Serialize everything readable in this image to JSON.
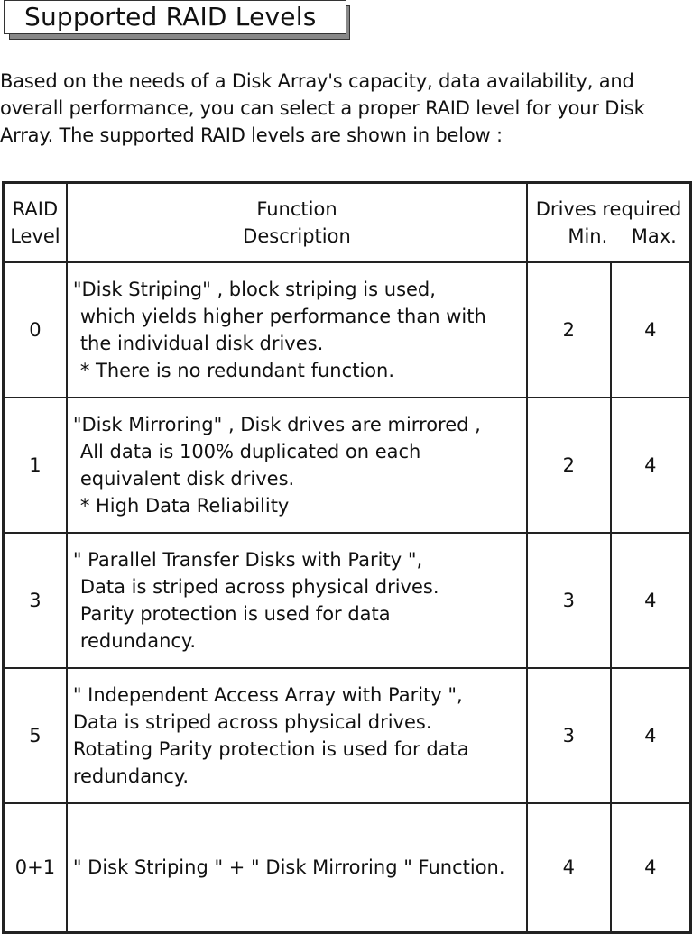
{
  "title": "Supported RAID Levels",
  "intro": "Based on the needs of a Disk Array's capacity, data availability, and overall performance, you can select a proper RAID level for your Disk Array. The supported RAID levels are shown in below :",
  "table": {
    "headers": {
      "level_line1": "RAID",
      "level_line2": "Level",
      "function_line1": "Function",
      "function_line2": "Description",
      "drives": "Drives required",
      "min": "Min.",
      "max": "Max."
    },
    "rows": [
      {
        "level": "0",
        "lines": [
          "\"Disk Striping\" , block striping is used,",
          "which yields higher performance than with",
          "the individual disk drives.",
          "* There is no redundant function."
        ],
        "min": "2",
        "max": "4"
      },
      {
        "level": "1",
        "lines": [
          "\"Disk Mirroring\" , Disk drives are mirrored ,",
          "All data is 100% duplicated on each",
          "equivalent disk drives.",
          "* High Data Reliability"
        ],
        "min": "2",
        "max": "4"
      },
      {
        "level": "3",
        "lines": [
          "\" Parallel Transfer Disks with Parity \",",
          "Data is striped across physical drives.",
          "Parity protection is used for data",
          "redundancy."
        ],
        "min": "3",
        "max": "4"
      },
      {
        "level": "5",
        "lines": [
          "\" Independent Access Array with Parity \",",
          "Data is striped across physical drives.",
          "Rotating Parity protection is used for data",
          "redundancy."
        ],
        "min": "3",
        "max": "4"
      },
      {
        "level": "0+1",
        "lines": [
          "\" Disk Striping \" + \" Disk Mirroring \" Function."
        ],
        "min": "4",
        "max": "4"
      }
    ]
  }
}
